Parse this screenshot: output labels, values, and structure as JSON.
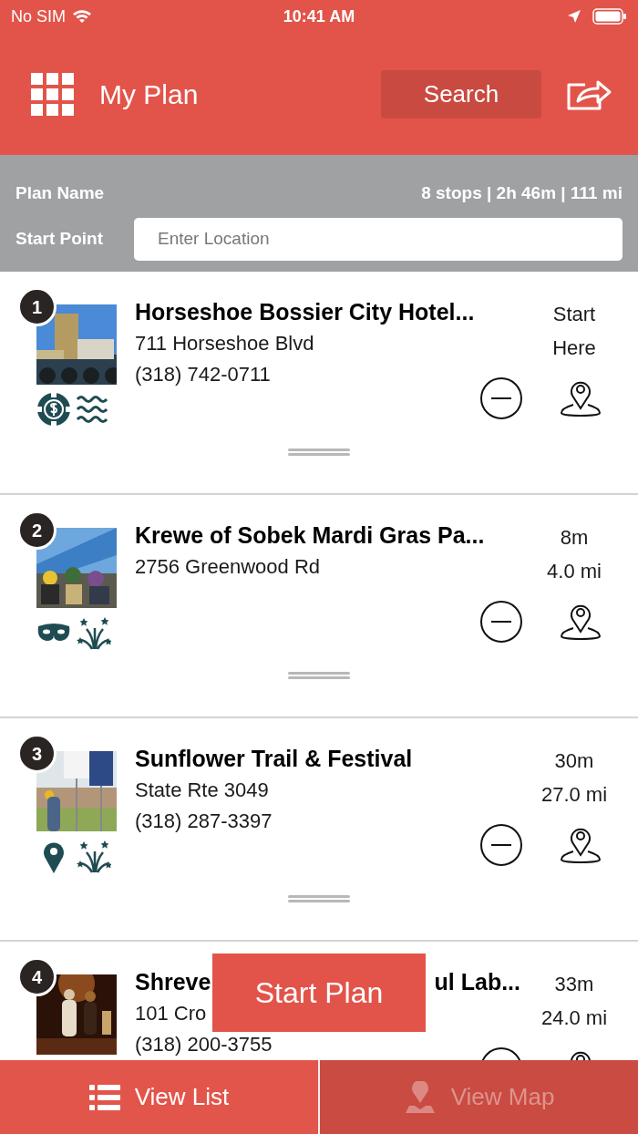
{
  "status_bar": {
    "carrier": "No SIM",
    "time": "10:41 AM"
  },
  "header": {
    "title": "My Plan",
    "search_button": "Search"
  },
  "plan": {
    "name_label": "Plan Name",
    "summary": "8 stops | 2h 46m | 111 mi",
    "start_label": "Start Point",
    "start_placeholder": "Enter Location"
  },
  "stops": [
    {
      "number": "1",
      "title": "Horseshoe Bossier City Hotel...",
      "address": "711 Horseshoe Blvd",
      "phone": "(318) 742-0711",
      "stats": [
        "Start",
        "Here"
      ],
      "icons": [
        {
          "kind": "chip"
        },
        {
          "kind": "waves"
        }
      ]
    },
    {
      "number": "2",
      "title": "Krewe of Sobek Mardi Gras Pa...",
      "address": "2756 Greenwood Rd",
      "stats": [
        "8m",
        "4.0 mi"
      ],
      "icons": [
        {
          "kind": "mask"
        },
        {
          "kind": "fireworks"
        }
      ]
    },
    {
      "number": "3",
      "title": "Sunflower Trail & Festival",
      "address": "State Rte 3049",
      "phone": "(318) 287-3397",
      "stats": [
        "30m",
        "27.0 mi"
      ],
      "icons": [
        {
          "kind": "pin"
        },
        {
          "kind": "fireworks"
        }
      ]
    },
    {
      "number": "4",
      "title_parts": [
        "Shreve",
        "ul Lab..."
      ],
      "address": "101 Cro",
      "phone": "(318) 200-3755",
      "stats": [
        "33m",
        "24.0 mi"
      ]
    }
  ],
  "start_button": "Start Plan",
  "tabs": [
    {
      "kind": "list",
      "label": "View List",
      "selected": true
    },
    {
      "kind": "map",
      "label": "View Map",
      "selected": false
    }
  ]
}
